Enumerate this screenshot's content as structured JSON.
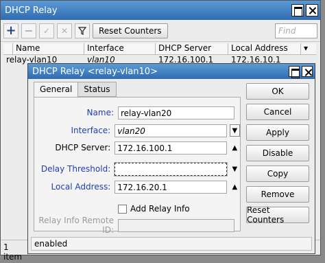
{
  "outer": {
    "title": "DHCP Relay",
    "toolbar": {
      "add_icon": "plus-icon",
      "remove_icon": "minus-icon",
      "enable_icon": "check-icon",
      "disable_icon": "x-icon",
      "filter_icon": "funnel-icon",
      "reset_label": "Reset Counters",
      "find_placeholder": "Find"
    },
    "columns": [
      "Name",
      "Interface",
      "DHCP Server",
      "Local Address"
    ],
    "rows": [
      {
        "name": "relay-vlan10",
        "interface": "vlan10",
        "dhcp_server": "172.16.100.1",
        "local_address": "172.16.10.1"
      }
    ],
    "status": {
      "count": "1 item",
      "state": "enabled"
    }
  },
  "dialog": {
    "title": "DHCP Relay <relay-vlan10>",
    "tabs": [
      "General",
      "Status"
    ],
    "fields": {
      "name": {
        "label": "Name:",
        "value": "relay-vlan20"
      },
      "interface": {
        "label": "Interface:",
        "value": "vlan20"
      },
      "dhcp_server": {
        "label": "DHCP Server:",
        "value": "172.16.100.1"
      },
      "delay_threshold": {
        "label": "Delay Threshold:",
        "value": ""
      },
      "local_address": {
        "label": "Local Address:",
        "value": "172.16.20.1"
      },
      "add_relay_info": {
        "label": "Add Relay Info"
      },
      "relay_info_remote_id": {
        "label": "Relay Info Remote ID:",
        "value": ""
      }
    },
    "buttons": [
      "OK",
      "Cancel",
      "Apply",
      "Disable",
      "Copy",
      "Remove",
      "Reset Counters"
    ],
    "status": "enabled"
  },
  "colors": {
    "title_bar": "#2f6bb0",
    "label_blue": "#1e3cb4"
  }
}
